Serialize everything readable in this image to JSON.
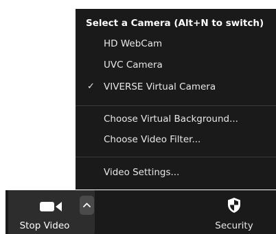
{
  "menu": {
    "header": "Select a Camera (Alt+N to switch)",
    "cameras": [
      {
        "label": "HD WebCam",
        "selected": false
      },
      {
        "label": "UVC Camera",
        "selected": false
      },
      {
        "label": "VIVERSE Virtual Camera",
        "selected": true
      }
    ],
    "check_glyph": "✓",
    "options": [
      {
        "label": "Choose Virtual Background..."
      },
      {
        "label": "Choose Video Filter..."
      }
    ],
    "settings": {
      "label": "Video Settings..."
    }
  },
  "toolbar": {
    "stop_video": {
      "label": "Stop Video",
      "icon": "video-camera-icon"
    },
    "caret": {
      "icon": "chevron-up-icon"
    },
    "security": {
      "label": "Security",
      "icon": "shield-icon"
    }
  },
  "colors": {
    "menu_bg": "#1a1a1a",
    "toolbar_bg": "#1a1a1a",
    "active_button_bg": "#2d2d2d",
    "caret_bg": "#4a4a4a",
    "text": "#ffffff"
  }
}
